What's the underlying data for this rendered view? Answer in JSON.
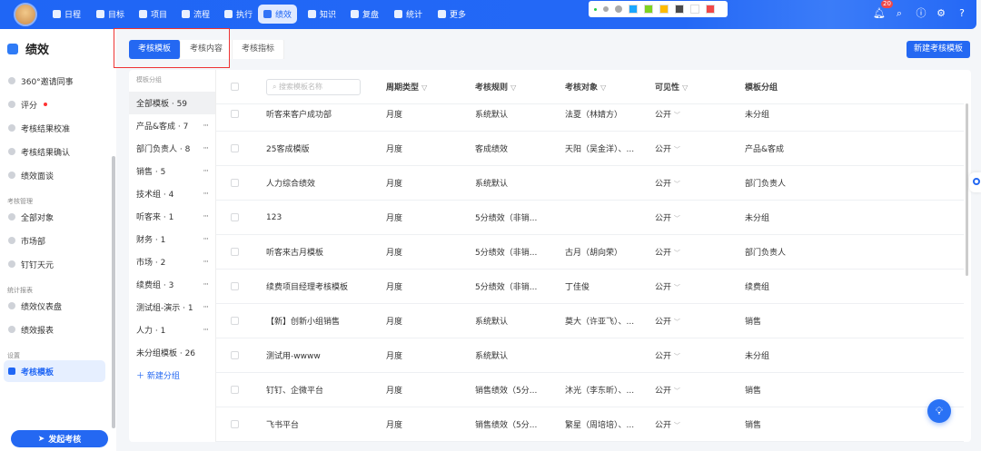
{
  "nav": {
    "items": [
      {
        "label": "日程",
        "icon": "calendar-icon"
      },
      {
        "label": "目标",
        "icon": "target-icon"
      },
      {
        "label": "项目",
        "icon": "cube-icon"
      },
      {
        "label": "流程",
        "icon": "flow-icon"
      },
      {
        "label": "执行",
        "icon": "task-icon"
      },
      {
        "label": "绩效",
        "icon": "performance-icon",
        "active": true
      },
      {
        "label": "知识",
        "icon": "book-icon"
      },
      {
        "label": "复盘",
        "icon": "review-icon"
      },
      {
        "label": "统计",
        "icon": "pie-icon"
      },
      {
        "label": "更多",
        "icon": "grid-icon"
      }
    ],
    "notification_count": "20",
    "palette": [
      "#1aa7ff",
      "#7ed321",
      "#ffbb00",
      "#4a4a4a",
      "#ffffff",
      "#f04848"
    ]
  },
  "sidebar": {
    "title": "绩效",
    "items": [
      {
        "label": "360°邀请同事"
      },
      {
        "label": "评分"
      },
      {
        "label": "考核结果校准"
      },
      {
        "label": "考核结果确认"
      },
      {
        "label": "绩效面谈"
      }
    ],
    "sections": [
      {
        "title": "考核管理",
        "items": [
          "全部对象",
          "市场部",
          "钉钉天元"
        ]
      },
      {
        "title": "统计报表",
        "items": [
          "绩效仪表盘",
          "绩效报表"
        ]
      },
      {
        "title": "设置",
        "items": [
          "考核模板"
        ]
      }
    ],
    "launch_label": "发起考核"
  },
  "tabs": [
    "考核模板",
    "考核内容",
    "考核指标"
  ],
  "new_template_label": "新建考核模板",
  "groups": {
    "header": "模板分组",
    "items": [
      {
        "label": "全部模板 · 59",
        "active": true
      },
      {
        "label": "产品&客成 · 7"
      },
      {
        "label": "部门负责人 · 8"
      },
      {
        "label": "销售 · 5"
      },
      {
        "label": "技术组 · 4"
      },
      {
        "label": "听客来 · 1"
      },
      {
        "label": "财务 · 1"
      },
      {
        "label": "市场 · 2"
      },
      {
        "label": "续费组 · 3"
      },
      {
        "label": "测试组-演示 · 1"
      },
      {
        "label": "人力 · 1"
      },
      {
        "label": "未分组模板 · 26"
      }
    ],
    "new_label": "新建分组"
  },
  "table": {
    "search_placeholder": "搜索模板名称",
    "headers": {
      "cycle": "周期类型",
      "rule": "考核规则",
      "target": "考核对象",
      "visibility": "可见性",
      "group": "模板分组"
    },
    "rows": [
      [
        "听客来客户成功部",
        "月度",
        "系统默认",
        "法夏（林婧方）",
        "公开",
        "未分组"
      ],
      [
        "25客成模版",
        "月度",
        "客成绩效",
        "天阳（吴金洋）、...",
        "公开",
        "产品&客成"
      ],
      [
        "人力综合绩效",
        "月度",
        "系统默认",
        "",
        "公开",
        "部门负责人"
      ],
      [
        "123",
        "月度",
        "5分绩效（非销...",
        "",
        "公开",
        "未分组"
      ],
      [
        "听客来古月模板",
        "月度",
        "5分绩效（非销...",
        "古月（胡向荣）",
        "公开",
        "部门负责人"
      ],
      [
        "续费项目经理考核模板",
        "月度",
        "5分绩效（非销...",
        "丁佳俊",
        "公开",
        "续费组"
      ],
      [
        "【新】创新小组销售",
        "月度",
        "系统默认",
        "莫大（许亚飞）、...",
        "公开",
        "销售"
      ],
      [
        "测试用-wwww",
        "月度",
        "系统默认",
        "",
        "公开",
        "未分组"
      ],
      [
        "钉钉、企微平台",
        "月度",
        "销售绩效（5分...",
        "沐光（李东昕）、...",
        "公开",
        "销售"
      ],
      [
        "飞书平台",
        "月度",
        "销售绩效（5分...",
        "繁星（周培培）、...",
        "公开",
        "销售"
      ]
    ]
  }
}
